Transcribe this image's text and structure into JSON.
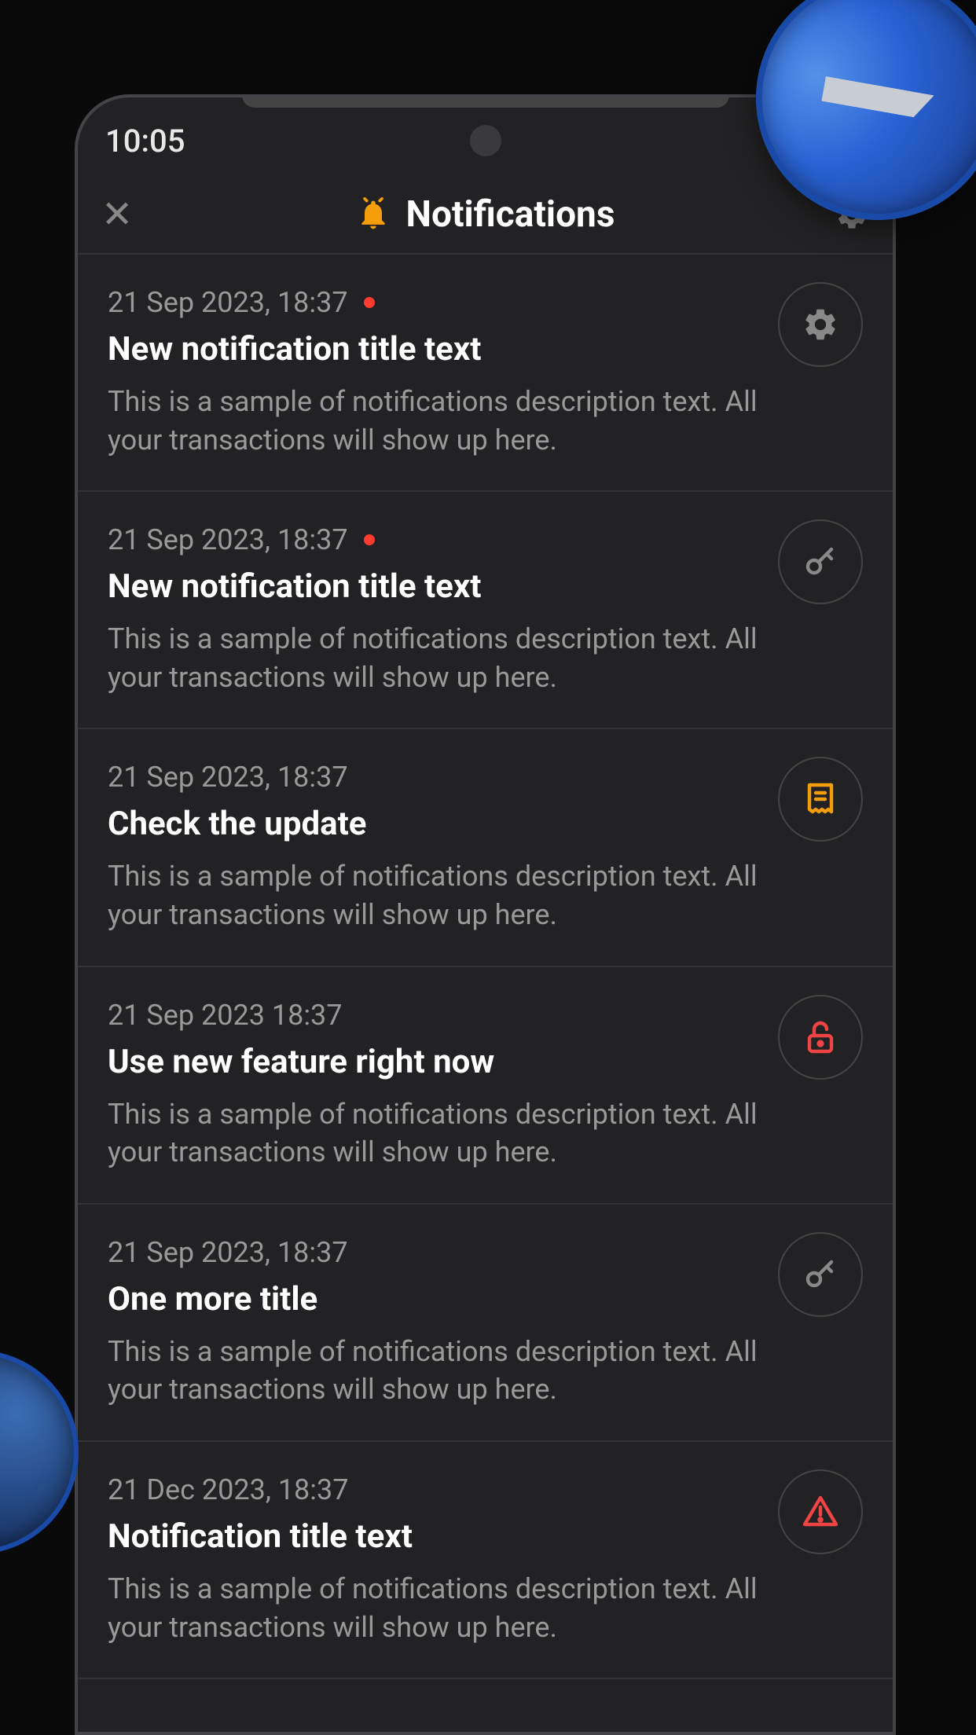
{
  "status": {
    "time": "10:05"
  },
  "header": {
    "title": "Notifications"
  },
  "notifications": [
    {
      "date": "21 Sep 2023, 18:37",
      "unread": true,
      "title": "New notification title text",
      "description": "This is a sample of notifications description text. All your transactions will show up here.",
      "icon": "gear",
      "iconColor": "#888"
    },
    {
      "date": "21 Sep 2023, 18:37",
      "unread": true,
      "title": "New notification title text",
      "description": "This is a sample of notifications description text. All your transactions will show up here.",
      "icon": "key",
      "iconColor": "#888"
    },
    {
      "date": "21 Sep 2023, 18:37",
      "unread": false,
      "title": "Check the update",
      "description": "This is a sample of notifications description text. All your transactions will show up here.",
      "icon": "receipt",
      "iconColor": "#f59e0b"
    },
    {
      "date": "21 Sep 2023 18:37",
      "unread": false,
      "title": "Use new feature right now",
      "description": "This is a sample of notifications description text. All your transactions will show up here.",
      "icon": "lock",
      "iconColor": "#ef4444"
    },
    {
      "date": "21 Sep 2023, 18:37",
      "unread": false,
      "title": "One more title",
      "description": "This is a sample of notifications description text. All your transactions will show up here.",
      "icon": "key",
      "iconColor": "#888"
    },
    {
      "date": "21 Dec 2023, 18:37",
      "unread": false,
      "title": "Notification title text",
      "description": "This is a sample of notifications description text. All your transactions will show up here.",
      "icon": "warning",
      "iconColor": "#ef4444"
    }
  ]
}
